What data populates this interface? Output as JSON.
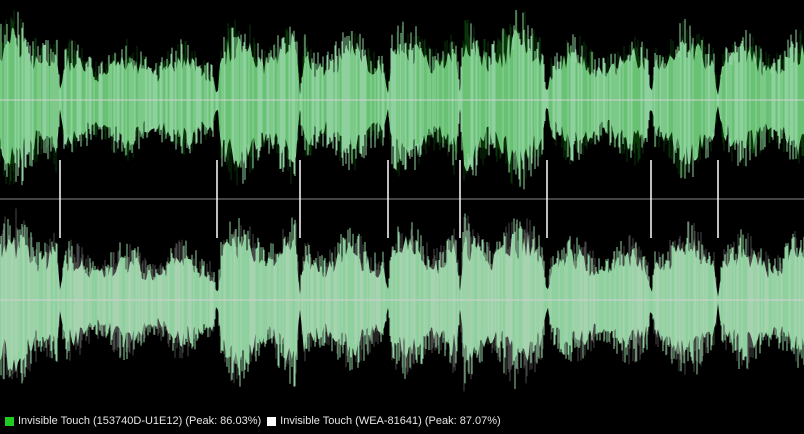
{
  "colors": {
    "background": "#000000",
    "waveform_fill": "#8fd19e",
    "waveform_edge_track1": "#1fa31f",
    "waveform_edge_track2": "#d8d8d8",
    "center_line": "#c8c8c8",
    "channel_divider": "#8a8a8a",
    "marker": "#ffffff",
    "legend_text": "#e6e6e6"
  },
  "legend": {
    "items": [
      {
        "label": "Invisible Touch (153740D-U1E12) (Peak: 86.03%)",
        "swatch_color": "#1fcc1f"
      },
      {
        "label": "Invisible Touch (WEA-81641) (Peak: 87.07%)",
        "swatch_color": "#ffffff"
      }
    ]
  },
  "waveform": {
    "channels": [
      "left",
      "right"
    ],
    "segment_boundaries_fraction": [
      0.075,
      0.27,
      0.373,
      0.482,
      0.572,
      0.68,
      0.81,
      0.893
    ],
    "segment_levels": [
      0.9,
      0.6,
      0.85,
      0.72,
      0.8,
      0.9,
      0.65,
      0.8,
      0.7
    ]
  }
}
